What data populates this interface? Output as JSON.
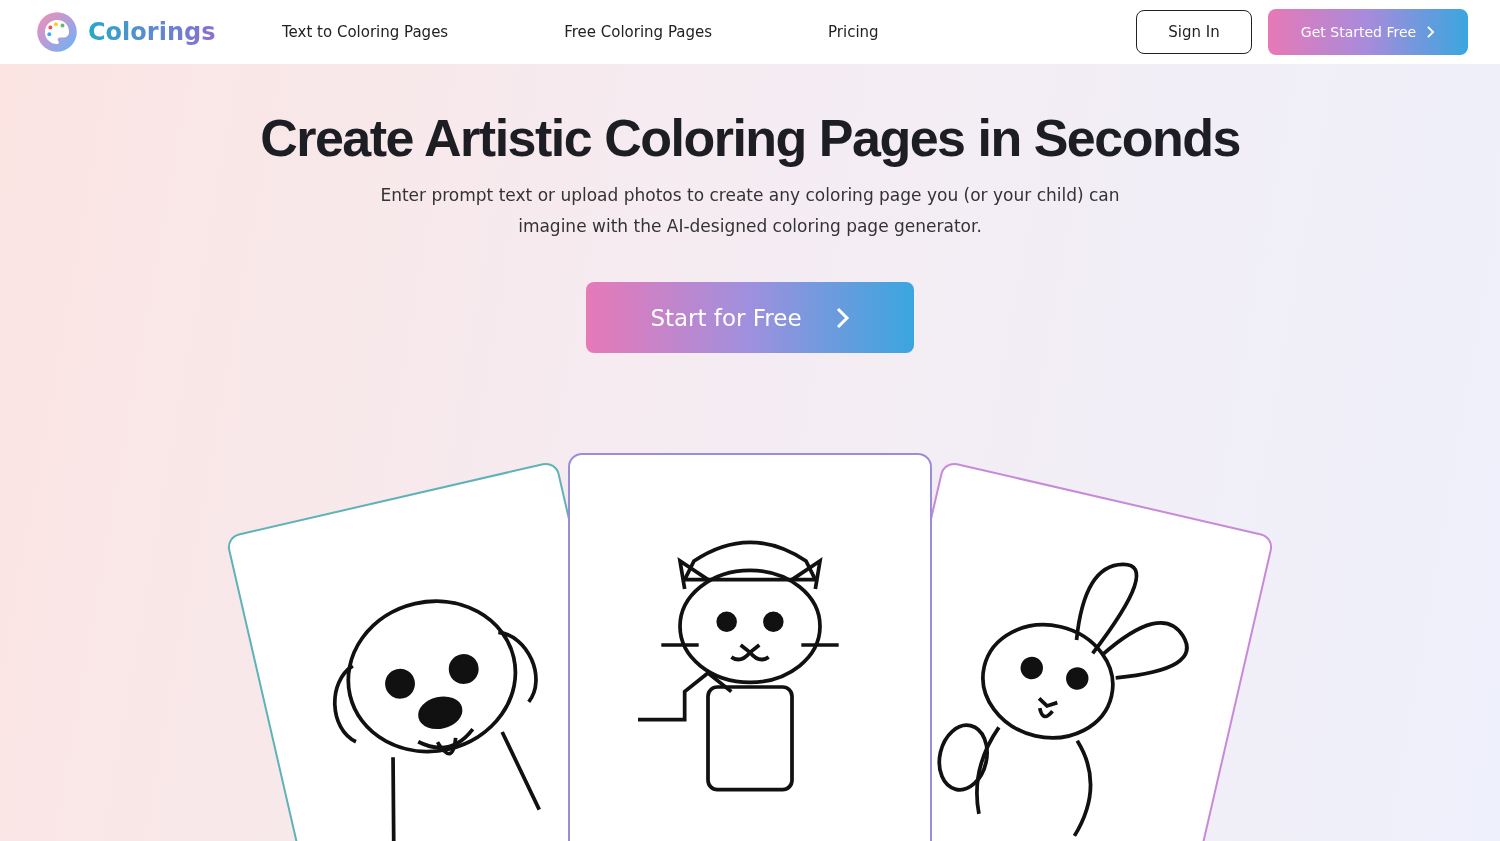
{
  "header": {
    "logo": "Colorings",
    "nav": [
      "Text to Coloring Pages",
      "Free Coloring Pages",
      "Pricing"
    ],
    "sign_in": "Sign In",
    "get_started": "Get Started Free"
  },
  "hero": {
    "title": "Create Artistic Coloring Pages in Seconds",
    "subtitle": "Enter prompt text or upload photos to create any coloring page you (or your child) can imagine with the AI-designed coloring page generator.",
    "cta": "Start for Free"
  },
  "gallery": [
    {
      "kind": "puppy"
    },
    {
      "kind": "kitten"
    },
    {
      "kind": "bunny"
    }
  ]
}
